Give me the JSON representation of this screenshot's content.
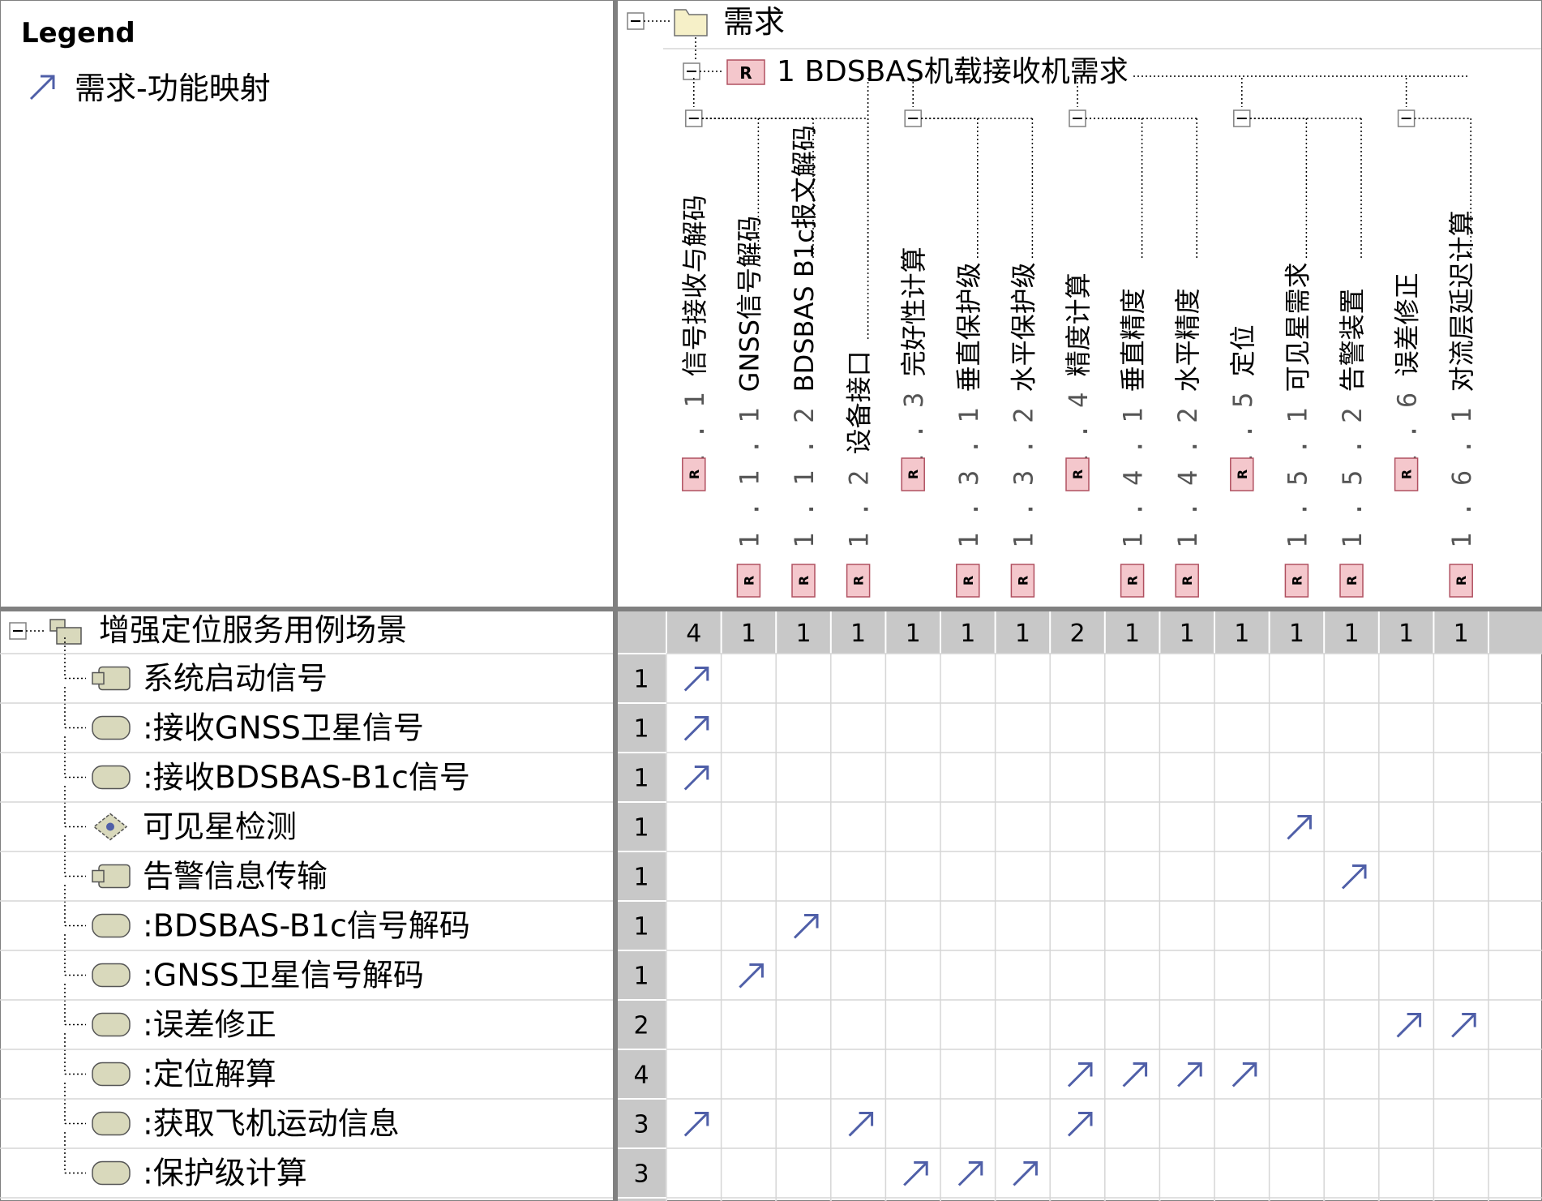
{
  "legend": {
    "title": "Legend",
    "items": [
      {
        "label": "需求-功能映射",
        "icon": "arrow-up-right-icon",
        "color": "#4f5fa8"
      }
    ]
  },
  "tree": {
    "root_label": "需求",
    "root_icon": "folder-icon",
    "req_label": "1 BDSBAS机载接收机需求",
    "req_badge": "R"
  },
  "columns": [
    {
      "number": "1.1",
      "label": "信号接收与解码",
      "group": true,
      "total": "4"
    },
    {
      "number": "1.1.1",
      "label": "GNSS信号解码",
      "group": false,
      "total": "1"
    },
    {
      "number": "1.1.2",
      "label": "BDSBAS B1c报文解码",
      "group": false,
      "total": "1"
    },
    {
      "number": "1.2",
      "label": "设备接口",
      "group": false,
      "total": "1"
    },
    {
      "number": "1.3",
      "label": "完好性计算",
      "group": true,
      "total": "1"
    },
    {
      "number": "1.3.1",
      "label": "垂直保护级",
      "group": false,
      "total": "1"
    },
    {
      "number": "1.3.2",
      "label": "水平保护级",
      "group": false,
      "total": "1"
    },
    {
      "number": "1.4",
      "label": "精度计算",
      "group": true,
      "total": "2"
    },
    {
      "number": "1.4.1",
      "label": "垂直精度",
      "group": false,
      "total": "1"
    },
    {
      "number": "1.4.2",
      "label": "水平精度",
      "group": false,
      "total": "1"
    },
    {
      "number": "1.5",
      "label": "定位",
      "group": true,
      "total": "1"
    },
    {
      "number": "1.5.1",
      "label": "可见星需求",
      "group": false,
      "total": "1"
    },
    {
      "number": "1.5.2",
      "label": "告警装置",
      "group": false,
      "total": "1"
    },
    {
      "number": "1.6",
      "label": "误差修正",
      "group": true,
      "total": "1"
    },
    {
      "number": "1.6.1",
      "label": "对流层延迟计算",
      "group": false,
      "total": "1"
    }
  ],
  "rows_root": {
    "label": "增强定位服务用例场景",
    "icon": "package-icon"
  },
  "rows": [
    {
      "label": "系统启动信号",
      "icon": "component-icon",
      "count": "1",
      "cells": [
        0
      ]
    },
    {
      "label": ":接收GNSS卫星信号",
      "icon": "action-icon",
      "count": "1",
      "cells": [
        0
      ]
    },
    {
      "label": ":接收BDSBAS-B1c信号",
      "icon": "action-icon",
      "count": "1",
      "cells": [
        0
      ]
    },
    {
      "label": "可见星检测",
      "icon": "decision-icon",
      "count": "1",
      "cells": [
        11
      ]
    },
    {
      "label": "告警信息传输",
      "icon": "component-icon",
      "count": "1",
      "cells": [
        12
      ]
    },
    {
      "label": ":BDSBAS-B1c信号解码",
      "icon": "action-icon",
      "count": "1",
      "cells": [
        2
      ]
    },
    {
      "label": ":GNSS卫星信号解码",
      "icon": "action-icon",
      "count": "1",
      "cells": [
        1
      ]
    },
    {
      "label": ":误差修正",
      "icon": "action-icon",
      "count": "2",
      "cells": [
        13,
        14
      ]
    },
    {
      "label": ":定位解算",
      "icon": "action-icon",
      "count": "4",
      "cells": [
        7,
        8,
        9,
        10
      ]
    },
    {
      "label": ":获取飞机运动信息",
      "icon": "action-icon",
      "count": "3",
      "cells": [
        0,
        3,
        7
      ]
    },
    {
      "label": ":保护级计算",
      "icon": "action-icon",
      "count": "3",
      "cells": [
        4,
        5,
        6
      ]
    }
  ],
  "colors": {
    "arrow": "#4f5fa8",
    "badge_fill": "#f4c7cc",
    "badge_stroke": "#b05060",
    "header_band": "#c8c8c8",
    "divider": "#808080",
    "grid": "#d6d6d6",
    "action_fill": "#d9d9bc",
    "folder_fill": "#f6f0c8"
  }
}
